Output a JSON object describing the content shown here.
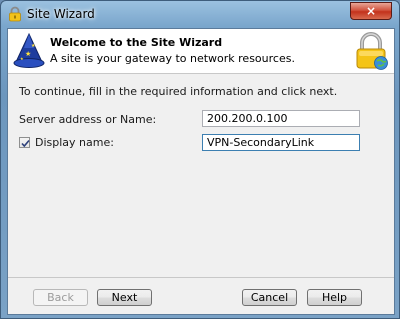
{
  "window": {
    "title": "Site Wizard",
    "close_glyph": "×"
  },
  "header": {
    "title": "Welcome to the Site Wizard",
    "subtitle": "A site is your gateway to network resources.",
    "left_icon": "wizard-hat-icon",
    "right_icon": "padlock-globe-icon"
  },
  "form": {
    "intro": "To continue, fill in the required information and click next.",
    "server_label": "Server address or Name:",
    "server_value": "200.200.0.100",
    "display_label": "Display name:",
    "display_checked": true,
    "display_value": "VPN-SecondaryLink"
  },
  "buttons": {
    "back": "Back",
    "next": "Next",
    "cancel": "Cancel",
    "help": "Help"
  },
  "colors": {
    "title_bar": "#7aa6cc",
    "close_button": "#c3321c",
    "client_bg": "#f0f0f0",
    "header_bg": "#ffffff",
    "focus_border": "#3c7fb1"
  }
}
